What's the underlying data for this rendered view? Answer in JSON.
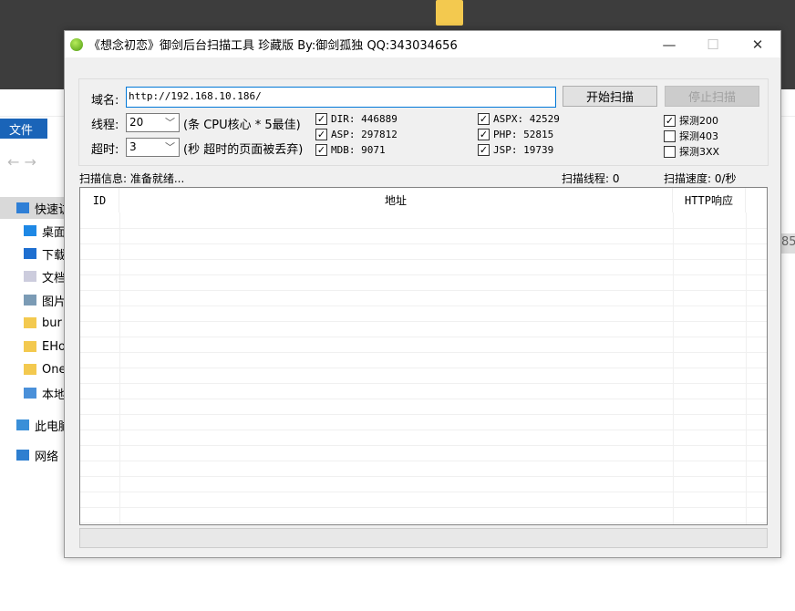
{
  "explorer": {
    "file_tab": "文件",
    "nav": [
      {
        "label": "快速访",
        "icon": "star-icon"
      },
      {
        "label": "桌面",
        "icon": "desktop-icon"
      },
      {
        "label": "下载",
        "icon": "download-icon"
      },
      {
        "label": "文档",
        "icon": "document-icon"
      },
      {
        "label": "图片",
        "icon": "picture-icon"
      },
      {
        "label": "bur",
        "icon": "folder-icon"
      },
      {
        "label": "EHo",
        "icon": "folder-icon"
      },
      {
        "label": "One",
        "icon": "folder-icon"
      },
      {
        "label": "本地",
        "icon": "drive-icon"
      },
      {
        "label": "此电脑",
        "icon": "computer-icon"
      },
      {
        "label": "网络",
        "icon": "network-icon"
      }
    ],
    "right_text": "85"
  },
  "window": {
    "title": "《想念初恋》御剑后台扫描工具 珍藏版 By:御剑孤独 QQ:343034656",
    "controls": {
      "minimize": "—",
      "maximize": "☐",
      "close": "✕"
    }
  },
  "form": {
    "domain_label": "域名:",
    "domain_value": "http://192.168.10.186/",
    "start_button": "开始扫描",
    "stop_button": "停止扫描",
    "threads_label": "线程:",
    "threads_value": "20",
    "threads_hint": "(条 CPU核心 * 5最佳)",
    "timeout_label": "超时:",
    "timeout_value": "3",
    "timeout_hint": "(秒 超时的页面被丢弃)",
    "dicts": [
      {
        "label": "DIR: 446889",
        "checked": true
      },
      {
        "label": "ASP: 297812",
        "checked": true
      },
      {
        "label": "MDB: 9071",
        "checked": true
      },
      {
        "label": "ASPX: 42529",
        "checked": true
      },
      {
        "label": "PHP: 52815",
        "checked": true
      },
      {
        "label": "JSP: 19739",
        "checked": true
      }
    ],
    "probes": [
      {
        "label": "探测200",
        "checked": true
      },
      {
        "label": "探测403",
        "checked": false
      },
      {
        "label": "探测3XX",
        "checked": false
      }
    ]
  },
  "status": {
    "info": "扫描信息: 准备就绪...",
    "threads": "扫描线程: 0",
    "speed": "扫描速度: 0/秒"
  },
  "table": {
    "columns": [
      "ID",
      "地址",
      "HTTP响应"
    ],
    "rows": []
  }
}
